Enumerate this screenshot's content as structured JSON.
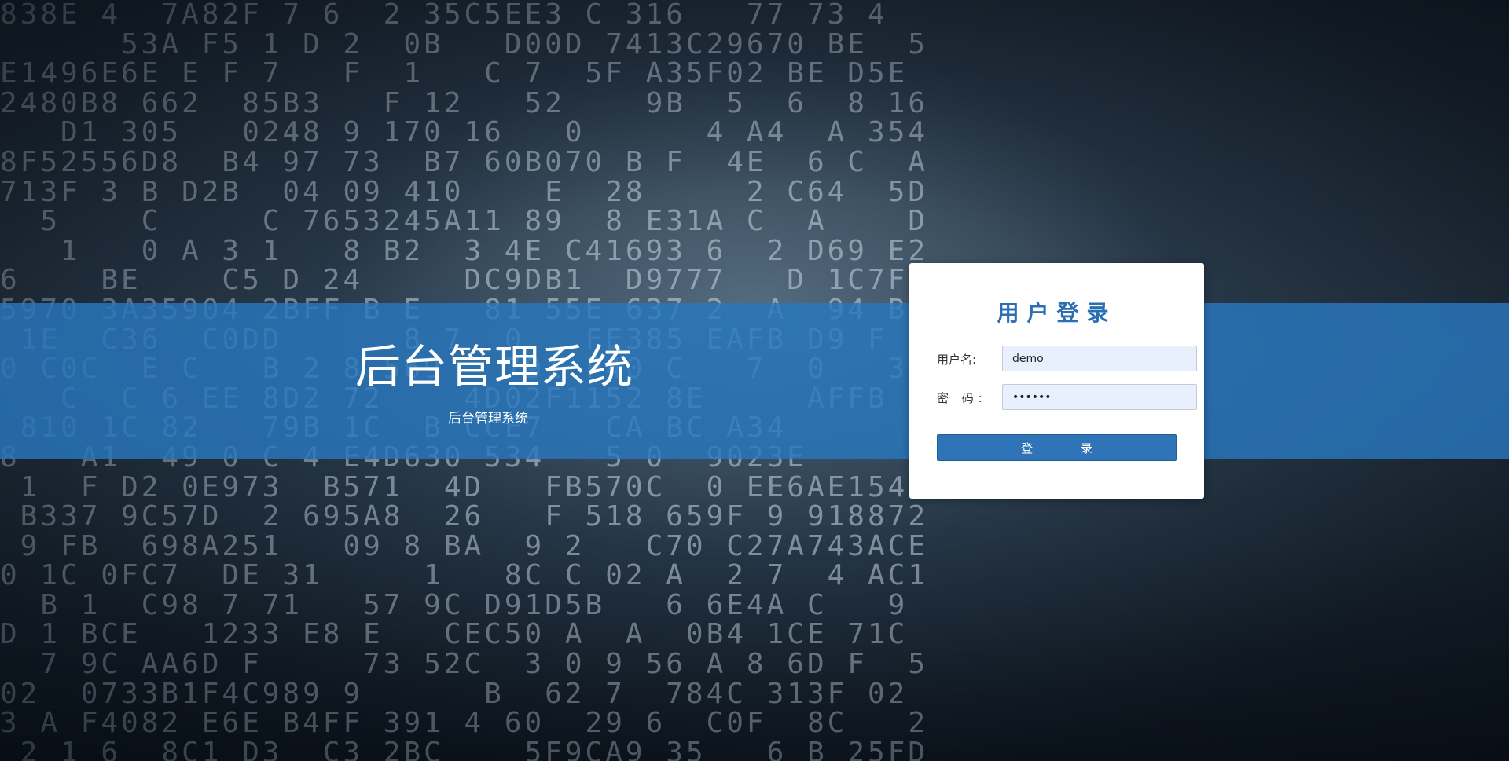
{
  "banner": {
    "title": "后台管理系统",
    "subtitle": "后台管理系统"
  },
  "login": {
    "title": "用户登录",
    "username_label": "用户名:",
    "username_value": "demo",
    "password_label": "密 码:",
    "password_value": "123456",
    "submit_label": "登 录"
  },
  "colors": {
    "accent": "#2e74b6",
    "band": "#2878be",
    "title_blue": "#2a6fb3"
  }
}
